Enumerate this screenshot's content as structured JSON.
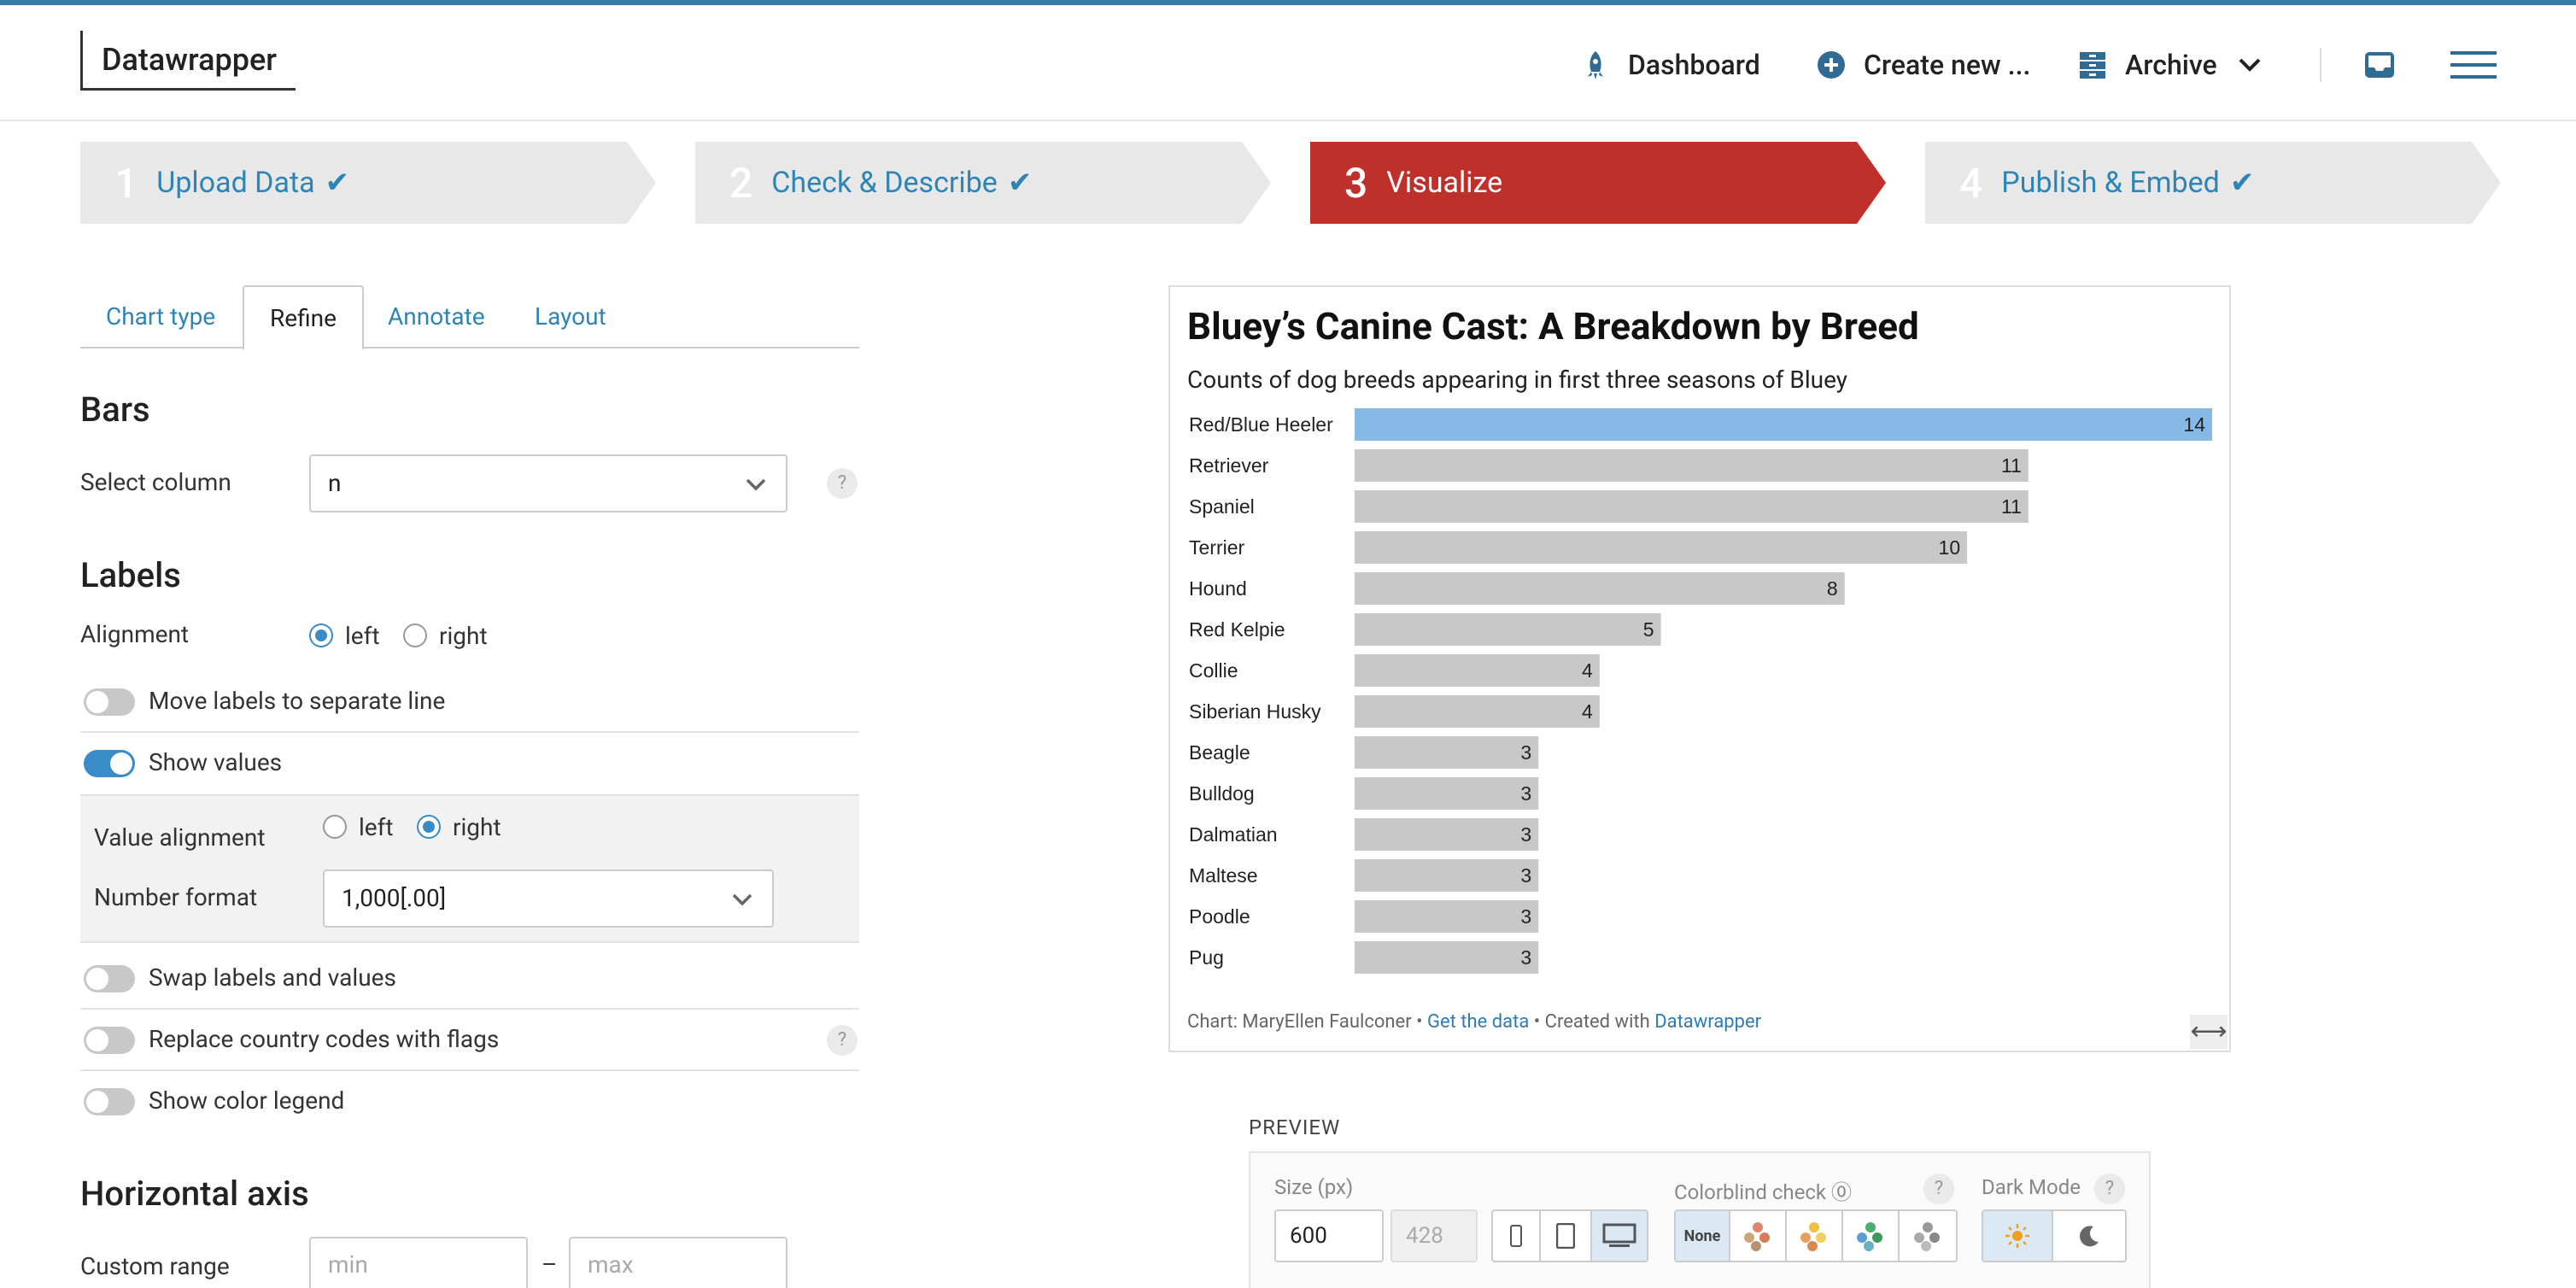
{
  "app": {
    "logo": "Datawrapper",
    "nav": {
      "dashboard": "Dashboard",
      "create_new": "Create new ...",
      "archive": "Archive"
    }
  },
  "steps": [
    {
      "num": "1",
      "label": "Upload Data",
      "check": "✔"
    },
    {
      "num": "2",
      "label": "Check & Describe",
      "check": "✔"
    },
    {
      "num": "3",
      "label": "Visualize",
      "check": ""
    },
    {
      "num": "4",
      "label": "Publish & Embed",
      "check": "✔"
    }
  ],
  "tabs": [
    "Chart type",
    "Refine",
    "Annotate",
    "Layout"
  ],
  "refine": {
    "bars_heading": "Bars",
    "select_column_label": "Select column",
    "select_column_value": "n",
    "help": "?",
    "labels_heading": "Labels",
    "alignment_label": "Alignment",
    "alignment_options": [
      "left",
      "right"
    ],
    "alignment_selected": "left",
    "move_labels": "Move labels to separate line",
    "show_values": "Show values",
    "value_alignment_label": "Value alignment",
    "value_alignment_options": [
      "left",
      "right"
    ],
    "value_alignment_selected": "right",
    "number_format_label": "Number format",
    "number_format_value": "1,000[.00]",
    "swap_labels": "Swap labels and values",
    "replace_country": "Replace country codes with flags",
    "show_color_legend": "Show color legend",
    "horizontal_axis_heading": "Horizontal axis",
    "custom_range_label": "Custom range",
    "min_placeholder": "min",
    "max_placeholder": "max",
    "range_sep": "–"
  },
  "chart_data": {
    "type": "bar",
    "title": "Bluey’s Canine Cast: A Breakdown by Breed",
    "subtitle": "Counts of dog breeds appearing in first three seasons of Bluey",
    "categories": [
      "Red/Blue Heeler",
      "Retriever",
      "Spaniel",
      "Terrier",
      "Hound",
      "Red Kelpie",
      "Collie",
      "Siberian Husky",
      "Beagle",
      "Bulldog",
      "Dalmatian",
      "Maltese",
      "Poodle",
      "Pug"
    ],
    "values": [
      14,
      11,
      11,
      10,
      8,
      5,
      4,
      4,
      3,
      3,
      3,
      3,
      3,
      3
    ],
    "highlight_index": 0,
    "colors": {
      "highlight": "#86b9e6",
      "default": "#c8c8c8"
    },
    "xlim": [
      0,
      14
    ]
  },
  "chart_footer": {
    "prefix": "Chart: MaryEllen Faulconer • ",
    "get_data": "Get the data",
    "middle": " • Created with ",
    "datawrapper": "Datawrapper"
  },
  "preview": {
    "heading": "PREVIEW",
    "size_label": "Size (px)",
    "width": "600",
    "height": "428",
    "colorblind_label": "Colorblind check",
    "colorblind_none": "None",
    "darkmode_label": "Dark Mode"
  }
}
